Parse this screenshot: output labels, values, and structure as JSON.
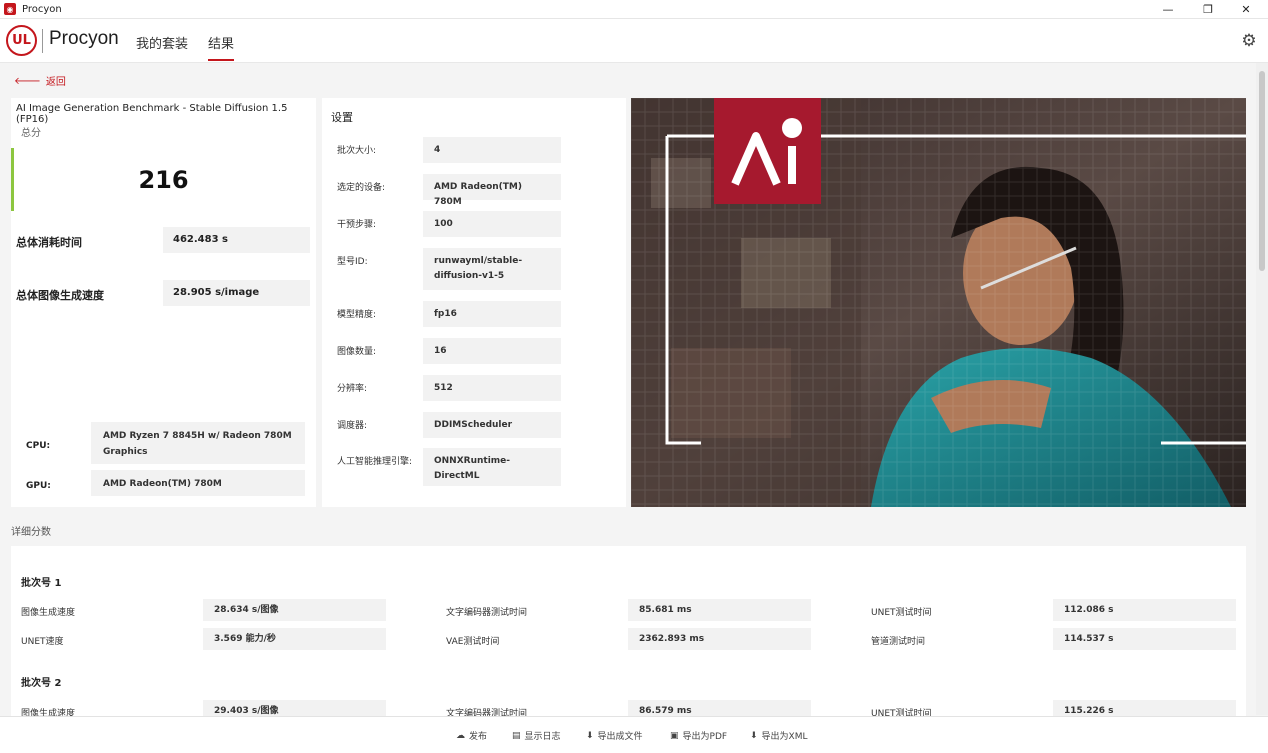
{
  "window": {
    "title": "Procyon",
    "minimize": "—",
    "maximize": "❐",
    "close": "✕"
  },
  "header": {
    "logo": "UL",
    "brand": "Procyon",
    "nav": [
      "我的套装",
      "结果"
    ],
    "active_nav": 1
  },
  "back_label": "返回",
  "summary": {
    "benchmark_title": "AI Image Generation Benchmark - Stable Diffusion 1.5 (FP16)",
    "score_label": "总分",
    "score": "216",
    "metrics": [
      {
        "label": "总体消耗时间",
        "value": "462.483 s"
      },
      {
        "label": "总体图像生成速度",
        "value": "28.905 s/image"
      }
    ],
    "hardware": [
      {
        "label": "CPU:",
        "value": "AMD Ryzen 7 8845H w/ Radeon 780M Graphics"
      },
      {
        "label": "GPU:",
        "value": "AMD Radeon(TM) 780M"
      }
    ]
  },
  "settings": {
    "title": "设置",
    "items": [
      {
        "label": "批次大小:",
        "value": "4"
      },
      {
        "label": "选定的设备:",
        "value": "AMD Radeon(TM) 780M"
      },
      {
        "label": "干预步骤:",
        "value": "100"
      },
      {
        "label": "型号ID:",
        "value": "runwayml/stable-diffusion-v1-5"
      },
      {
        "label": "模型精度:",
        "value": "fp16"
      },
      {
        "label": "图像数量:",
        "value": "16"
      },
      {
        "label": "分辨率:",
        "value": "512"
      },
      {
        "label": "调度器:",
        "value": "DDIMScheduler"
      },
      {
        "label": "人工智能推理引擎:",
        "value": "ONNXRuntime-DirectML"
      }
    ]
  },
  "hero": {
    "badge": "Ai",
    "colors": {
      "brand": "#a6192e",
      "teal": "#1f8f96"
    }
  },
  "details": {
    "title": "详细分数",
    "batches": [
      {
        "title": "批次号 1",
        "rows": [
          [
            {
              "label": "图像生成速度",
              "value": "28.634 s/图像"
            },
            {
              "label": "文字编码器测试时间",
              "value": "85.681 ms"
            },
            {
              "label": "UNET测试时间",
              "value": "112.086 s"
            }
          ],
          [
            {
              "label": "UNET速度",
              "value": "3.569 能力/秒"
            },
            {
              "label": "VAE测试时间",
              "value": "2362.893 ms"
            },
            {
              "label": "管道测试时间",
              "value": "114.537 s"
            }
          ]
        ]
      },
      {
        "title": "批次号 2",
        "rows": [
          [
            {
              "label": "图像生成速度",
              "value": "29.403 s/图像"
            },
            {
              "label": "文字编码器测试时间",
              "value": "86.579 ms"
            },
            {
              "label": "UNET测试时间",
              "value": "115.226 s"
            }
          ]
        ]
      }
    ]
  },
  "footer": [
    {
      "icon": "cloud-upload-icon",
      "glyph": "☁",
      "label": "发布"
    },
    {
      "icon": "log-icon",
      "glyph": "▤",
      "label": "显示日志"
    },
    {
      "icon": "download-icon",
      "glyph": "⬇",
      "label": "导出成文件"
    },
    {
      "icon": "save-icon",
      "glyph": "▣",
      "label": "导出为PDF"
    },
    {
      "icon": "download-icon",
      "glyph": "⬇",
      "label": "导出为XML"
    }
  ]
}
